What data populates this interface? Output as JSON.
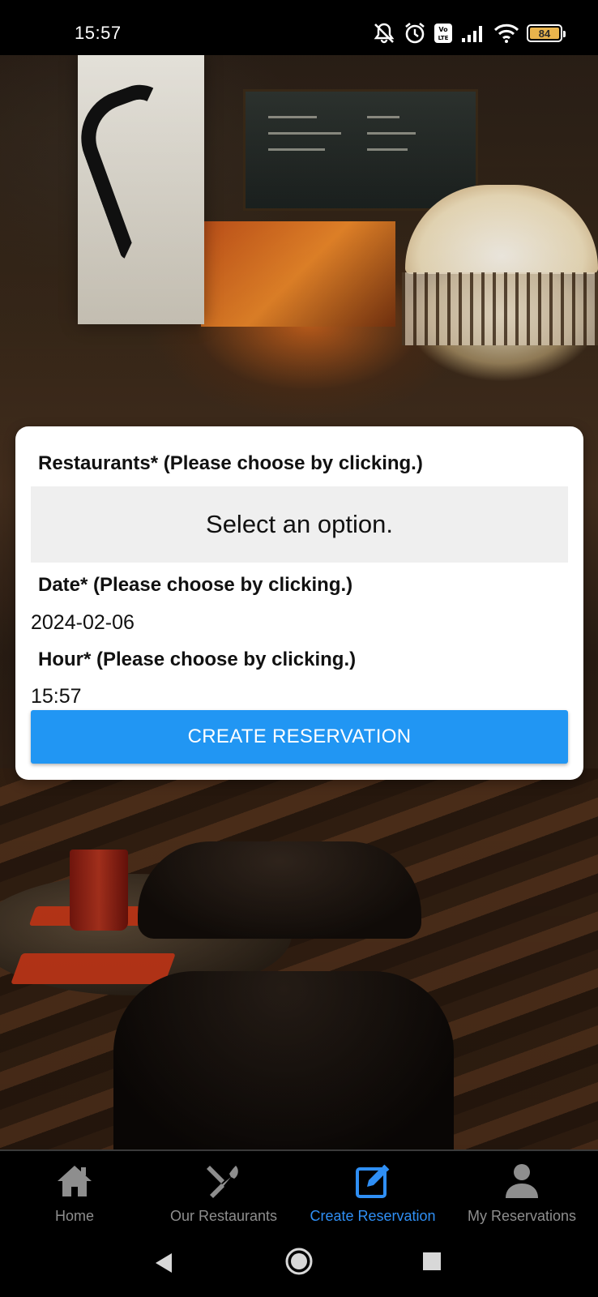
{
  "status_bar": {
    "time": "15:57",
    "battery_level": "84",
    "icons": [
      "mute-icon",
      "alarm-icon",
      "volte-icon",
      "signal-icon",
      "wifi-icon",
      "battery-icon"
    ],
    "battery_color": "#e9b44c"
  },
  "form": {
    "restaurant_label": "Restaurants* (Please choose by clicking.)",
    "restaurant_placeholder": "Select an option.",
    "date_label": "Date* (Please choose by clicking.)",
    "date_value": "2024-02-06",
    "hour_label": "Hour* (Please choose by clicking.)",
    "hour_value": "15:57",
    "submit_label": "CREATE RESERVATION",
    "submit_color": "#2196f3"
  },
  "bottom_nav": {
    "items": [
      {
        "label": "Home",
        "icon": "home-icon",
        "active": false
      },
      {
        "label": "Our Restaurants",
        "icon": "utensils-icon",
        "active": false
      },
      {
        "label": "Create Reservation",
        "icon": "edit-icon",
        "active": true
      },
      {
        "label": "My Reservations",
        "icon": "user-icon",
        "active": false
      }
    ],
    "active_color": "#2f8ff5",
    "inactive_color": "#8e8e8e"
  },
  "system_nav": {
    "buttons": [
      "back-icon",
      "home-circle-icon",
      "recents-icon"
    ]
  }
}
